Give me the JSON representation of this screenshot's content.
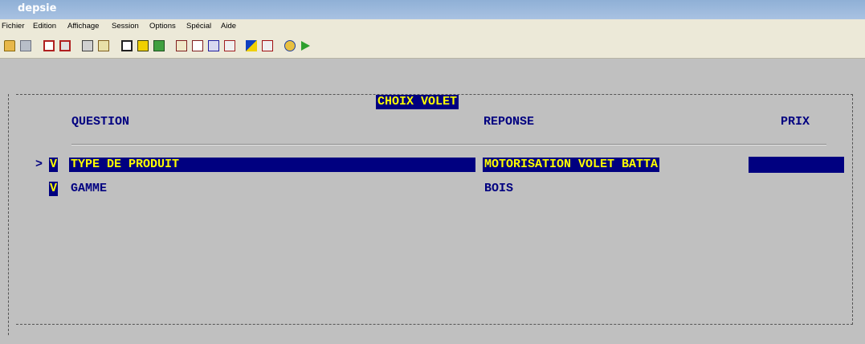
{
  "window": {
    "title": "depsie"
  },
  "menu": [
    "Fichier",
    "Edition",
    "Affichage",
    "Session",
    "Options",
    "Spécial",
    "Aide"
  ],
  "toolbar": {
    "icons": [
      "open-folder-icon",
      "save-icon",
      "copy-icon",
      "paste-icon",
      "print-icon",
      "print-preview-icon",
      "window-icon",
      "info-icon",
      "export-icon",
      "form-icon",
      "grid-icon",
      "font-icon",
      "keyboard-icon",
      "help-pointer-icon",
      "dos-icon",
      "connect-icon",
      "run-icon"
    ]
  },
  "screen": {
    "title": "CHOIX VOLET",
    "columns": {
      "question": "QUESTION",
      "reponse": "REPONSE",
      "prix": "PRIX"
    },
    "cursor": ">",
    "rows": [
      {
        "flag": "V",
        "question": "TYPE DE PRODUIT",
        "reponse": "MOTORISATION VOLET BATTA",
        "selected": true
      },
      {
        "flag": "V",
        "question": "GAMME",
        "reponse": "BOIS",
        "selected": false
      }
    ]
  }
}
